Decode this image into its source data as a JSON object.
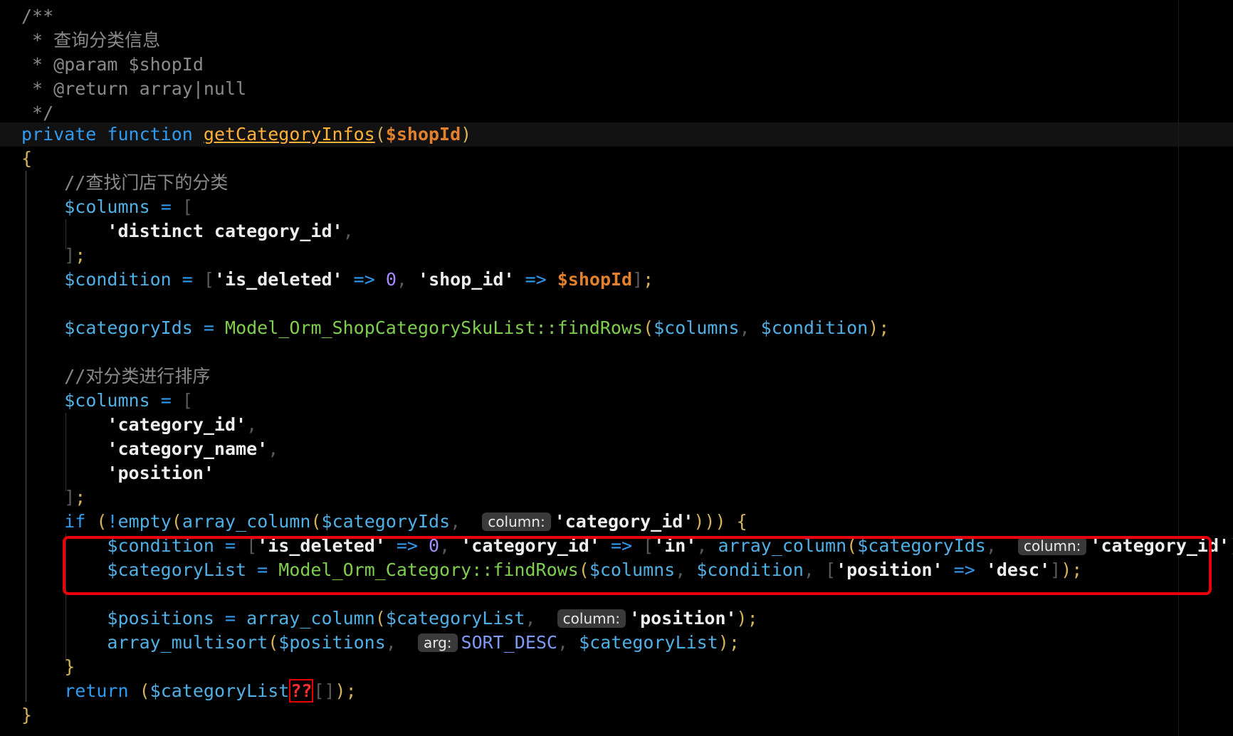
{
  "editor": {
    "doc_comment": {
      "open": "/**",
      "summary": " * 查询分类信息",
      "param": " * @param $shopId",
      "return_tag": " * @return array|null",
      "close": " */"
    },
    "signature": {
      "modifier": "private",
      "keyword": "function",
      "name": "getCategoryInfos",
      "param": "$shopId"
    },
    "comment_1": "//查找门店下的分类",
    "comment_2": "//对分类进行排序",
    "var_columns": "$columns",
    "var_condition": "$condition",
    "var_category_ids": "$categoryIds",
    "var_category_list": "$categoryList",
    "var_positions": "$positions",
    "var_shop_id": "$shopId",
    "str_distinct": "'distinct category_id'",
    "str_is_deleted": "'is_deleted'",
    "str_shop_id": "'shop_id'",
    "str_category_id": "'category_id'",
    "str_category_name": "'category_name'",
    "str_position": "'position'",
    "str_in": "'in'",
    "str_desc": "'desc'",
    "num_zero": "0",
    "class_sku_list": "Model_Orm_ShopCategorySkuList",
    "class_category": "Model_Orm_Category",
    "method_find_rows": "findRows",
    "fn_empty": "empty",
    "fn_array_column": "array_column",
    "fn_array_multisort": "array_multisort",
    "const_sort_desc": "SORT_DESC",
    "kw_if": "if",
    "kw_return": "return",
    "hint_column": "column:",
    "hint_arg": "arg:",
    "null_coalesce": "??"
  },
  "annotation": {
    "color": "#e8000c"
  }
}
